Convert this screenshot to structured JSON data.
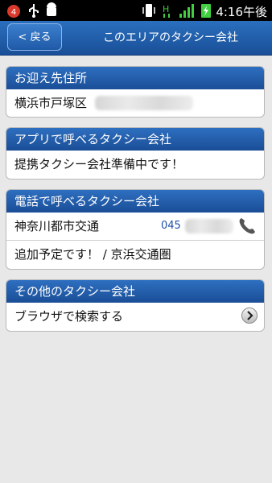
{
  "status_bar": {
    "time": "4:16午後",
    "notification_count": "4",
    "battery_color": "#3fcf3f"
  },
  "header": {
    "back_label": "< 戻る",
    "title": "このエリアのタクシー会社"
  },
  "pickup": {
    "header": "お迎え先住所",
    "address": "横浜市戸塚区"
  },
  "app_taxi": {
    "header": "アプリで呼べるタクシー会社",
    "message": "提携タクシー会社準備中です！"
  },
  "phone_taxi": {
    "header": "電話で呼べるタクシー会社",
    "company": "神奈川都市交通",
    "phone_prefix": "045",
    "note": "追加予定です！ / 京浜交通圏"
  },
  "other_taxi": {
    "header": "その他のタクシー会社",
    "browser_search": "ブラウザで検索する"
  },
  "colors": {
    "accent": "#1f5aa8",
    "header_gradient_top": "#2e6fc0",
    "header_gradient_bottom": "#1a4e97"
  }
}
